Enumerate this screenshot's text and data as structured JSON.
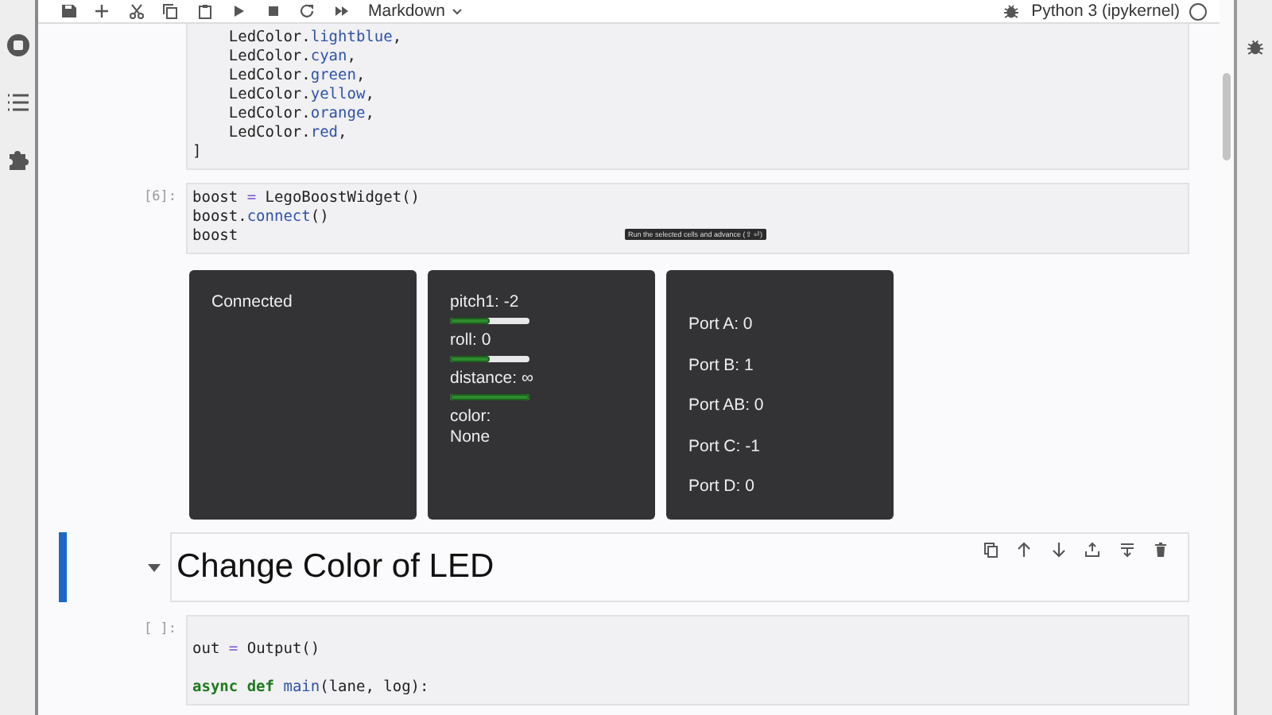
{
  "toolbar": {
    "buttons": [
      {
        "kind": "save"
      },
      {
        "kind": "add"
      },
      {
        "kind": "cut"
      },
      {
        "kind": "copy"
      },
      {
        "kind": "paste"
      },
      {
        "kind": "run"
      },
      {
        "kind": "stop"
      },
      {
        "kind": "restart"
      },
      {
        "kind": "run-all"
      }
    ],
    "cell_type": "Markdown",
    "kernel": "Python 3 (ipykernel)"
  },
  "left_sidebar": [
    {
      "kind": "stop"
    },
    {
      "kind": "list"
    },
    {
      "kind": "puzzle"
    }
  ],
  "cells": [
    {
      "kind": "code",
      "lines": [
        {
          "kind": "code",
          "tokens": [
            {
              "text": "    LedColor.",
              "kind": "plain"
            },
            {
              "text": "lightblue",
              "kind": "attribute"
            },
            {
              "text": ",",
              "kind": "plain"
            }
          ]
        },
        {
          "kind": "code",
          "tokens": [
            {
              "text": "    LedColor.",
              "kind": "plain"
            },
            {
              "text": "cyan",
              "kind": "attribute"
            },
            {
              "text": ",",
              "kind": "plain"
            }
          ]
        },
        {
          "kind": "code",
          "tokens": [
            {
              "text": "    LedColor.",
              "kind": "plain"
            },
            {
              "text": "green",
              "kind": "attribute"
            },
            {
              "text": ",",
              "kind": "plain"
            }
          ]
        },
        {
          "kind": "code",
          "tokens": [
            {
              "text": "    LedColor.",
              "kind": "plain"
            },
            {
              "text": "yellow",
              "kind": "attribute"
            },
            {
              "text": ",",
              "kind": "plain"
            }
          ]
        },
        {
          "kind": "code",
          "tokens": [
            {
              "text": "    LedColor.",
              "kind": "plain"
            },
            {
              "text": "orange",
              "kind": "attribute"
            },
            {
              "text": ",",
              "kind": "plain"
            }
          ]
        },
        {
          "kind": "code",
          "tokens": [
            {
              "text": "    LedColor.",
              "kind": "plain"
            },
            {
              "text": "red",
              "kind": "attribute"
            },
            {
              "text": ",",
              "kind": "plain"
            }
          ]
        },
        {
          "kind": "code",
          "tokens": [
            {
              "text": "]",
              "kind": "plain"
            }
          ]
        }
      ]
    },
    {
      "kind": "code",
      "prompt": "[6]:",
      "tooltip": "Run the selected cells and advance (⇧ ⏎)",
      "lines": [
        {
          "kind": "code",
          "tokens": [
            {
              "text": "boost ",
              "kind": "plain"
            },
            {
              "text": "=",
              "kind": "operator"
            },
            {
              "text": " LegoBoostWidget()",
              "kind": "plain"
            }
          ]
        },
        {
          "kind": "code",
          "tokens": [
            {
              "text": "boost.",
              "kind": "plain"
            },
            {
              "text": "connect",
              "kind": "attribute"
            },
            {
              "text": "()",
              "kind": "plain"
            }
          ]
        },
        {
          "kind": "code",
          "tokens": [
            {
              "text": "boost",
              "kind": "plain"
            }
          ]
        }
      ],
      "output": {
        "panels": [
          {
            "kind": "status",
            "items": [
              {
                "text": "Connected"
              }
            ]
          },
          {
            "kind": "sensors",
            "items": [
              {
                "text": "pitch1: -2",
                "level": 0.5
              },
              {
                "text": "roll: 0",
                "level": 0.5
              },
              {
                "text": "distance: ∞",
                "level": 1
              },
              {
                "text": "color:"
              },
              {
                "text": "None"
              }
            ]
          },
          {
            "kind": "ports",
            "items": [
              {
                "text": "Port A: 0"
              },
              {
                "text": "Port B: 1"
              },
              {
                "text": "Port AB: 0"
              },
              {
                "text": "Port C: -1"
              },
              {
                "text": "Port D: 0"
              }
            ]
          }
        ]
      }
    },
    {
      "kind": "heading",
      "selected": true,
      "expanded": true,
      "text": "Change Color of LED",
      "tools": [
        {
          "kind": "duplicate"
        },
        {
          "kind": "up"
        },
        {
          "kind": "down"
        },
        {
          "kind": "insert-above"
        },
        {
          "kind": "insert-below"
        },
        {
          "kind": "delete"
        }
      ]
    },
    {
      "kind": "code",
      "prompt": "[ ]:",
      "lines": [
        {
          "kind": "blank"
        },
        {
          "kind": "code",
          "tokens": [
            {
              "text": "out ",
              "kind": "plain"
            },
            {
              "text": "=",
              "kind": "operator"
            },
            {
              "text": " Output()",
              "kind": "plain"
            }
          ]
        },
        {
          "kind": "blank"
        },
        {
          "kind": "code",
          "tokens": [
            {
              "text": "async",
              "kind": "keyword"
            },
            {
              "text": " def",
              "kind": "keyword"
            },
            {
              "text": " main",
              "kind": "function"
            },
            {
              "text": "(lane, log):",
              "kind": "plain"
            }
          ]
        }
      ]
    }
  ]
}
